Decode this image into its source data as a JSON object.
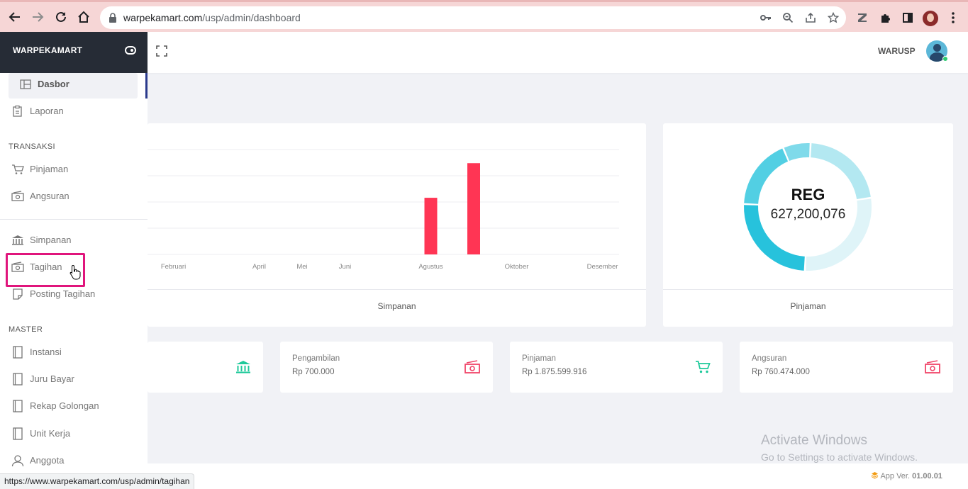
{
  "browser": {
    "url_host": "warpekamart.com",
    "url_path": "/usp/admin/dashboard",
    "status_url": "https://www.warpekamart.com/usp/admin/tagihan"
  },
  "sidebar": {
    "brand": "WARPEKAMART",
    "items": [
      {
        "label": "Dasbor",
        "icon": "dashboard-icon",
        "active": true
      },
      {
        "label": "Laporan",
        "icon": "report-icon"
      }
    ],
    "sections": [
      {
        "title": "TRANSAKSI",
        "items": [
          {
            "label": "Pinjaman",
            "icon": "cart-icon"
          },
          {
            "label": "Angsuran",
            "icon": "money-icon"
          }
        ]
      },
      {
        "items": [
          {
            "label": "Simpanan",
            "icon": "bank-icon"
          },
          {
            "label": "Tagihan",
            "icon": "money-icon"
          },
          {
            "label": "Posting Tagihan",
            "icon": "note-icon"
          }
        ]
      },
      {
        "title": "MASTER",
        "items": [
          {
            "label": "Instansi",
            "icon": "book-icon"
          },
          {
            "label": "Juru Bayar",
            "icon": "book-icon"
          },
          {
            "label": "Rekap Golongan",
            "icon": "book-icon"
          },
          {
            "label": "Unit Kerja",
            "icon": "book-icon"
          },
          {
            "label": "Anggota",
            "icon": "user-icon"
          }
        ]
      }
    ]
  },
  "header": {
    "user_name": "WARUSP"
  },
  "cards": {
    "simpanan_footer": "Simpanan",
    "pinjaman_footer": "Pinjaman",
    "donut_title": "REG",
    "donut_value": "627,200,076"
  },
  "chart_data": [
    {
      "type": "bar",
      "categories": [
        "Februari",
        "April",
        "Mei",
        "Juni",
        "Agustus",
        "Oktober",
        "Desember"
      ],
      "tick_labels": [
        "Februari",
        "April",
        "Mei",
        "Juni",
        "Agustus",
        "Oktober",
        "Desember"
      ],
      "bars": [
        {
          "month": "Agustus",
          "value": 0.54
        },
        {
          "month": "September",
          "value": 0.87
        }
      ],
      "color": "#ff3554",
      "grid": true,
      "ylim": [
        0,
        1
      ]
    },
    {
      "type": "pie",
      "slices": [
        {
          "value": 0.22,
          "color": "#b3e8f1"
        },
        {
          "value": 0.28,
          "color": "#dff4f8"
        },
        {
          "value": 0.25,
          "color": "#27c2dc"
        },
        {
          "value": 0.18,
          "color": "#52cfe3"
        },
        {
          "value": 0.07,
          "color": "#7fdaea"
        }
      ],
      "center_title": "REG",
      "center_value": "627,200,076"
    }
  ],
  "stats": [
    {
      "label": "",
      "value": "",
      "icon": "bank-icon",
      "color": "#1ec99a"
    },
    {
      "label": "Pengambilan",
      "value": "Rp 700.000",
      "icon": "money-icon",
      "color": "#f0456a"
    },
    {
      "label": "Pinjaman",
      "value": "Rp 1.875.599.916",
      "icon": "cart-icon",
      "color": "#1ec99a"
    },
    {
      "label": "Angsuran",
      "value": "Rp 760.474.000",
      "icon": "money-icon",
      "color": "#f0456a"
    }
  ],
  "watermark": {
    "line1": "Activate Windows",
    "line2": "Go to Settings to activate Windows."
  },
  "footer": {
    "app_ver_label": "App Ver.",
    "app_ver": "01.00.01"
  }
}
